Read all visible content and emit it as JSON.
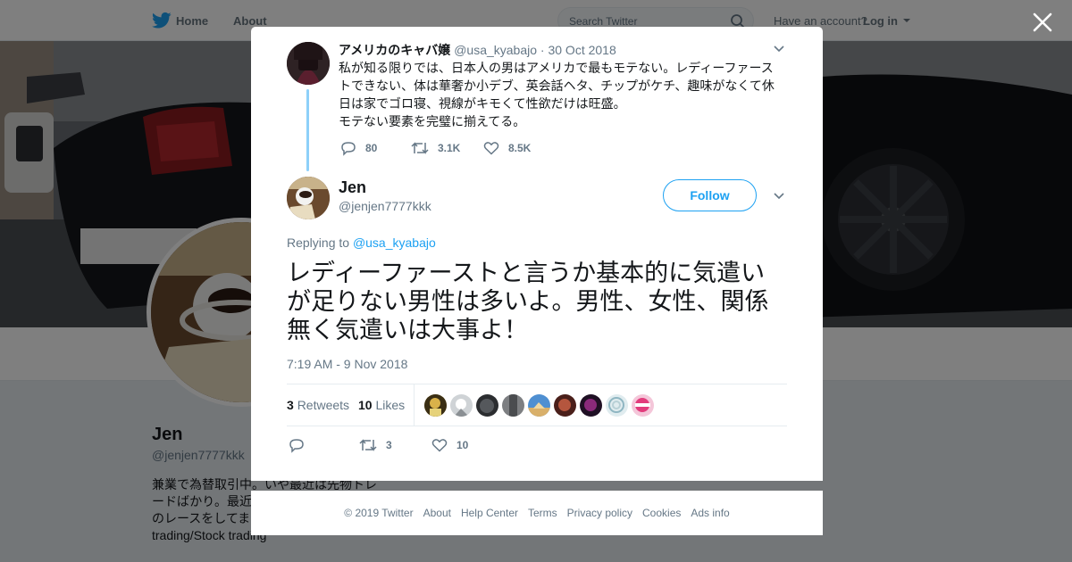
{
  "background": {
    "nav": {
      "home": "Home",
      "about": "About"
    },
    "search": {
      "placeholder": "Search Twitter"
    },
    "account": {
      "prompt": "Have an account?",
      "login": "Log in"
    },
    "profile": {
      "name": "Jen",
      "handle": "@jenjen7777kkk",
      "bio_lines": [
        "兼業で為替取引中。いや最近は先物トレ",
        "ードばかり。最近",
        "のレースをしてま",
        "trading/Stock trading"
      ]
    }
  },
  "parent_tweet": {
    "name": "アメリカのキャバ嬢",
    "handle": "@usa_kyabajo",
    "date": "· 30 Oct 2018",
    "text_lines": [
      "私が知る限りでは、日本人の男はアメリカで最もモテない。レディーファース",
      "トできない、体は華奢か小デブ、英会話ヘタ、チップがケチ、趣味がなくて休",
      "日は家でゴロ寝、視線がキモくて性欲だけは旺盛。",
      "モテない要素を完璧に揃えてる。"
    ],
    "replies": "80",
    "retweets": "3.1K",
    "likes": "8.5K"
  },
  "main_tweet": {
    "name": "Jen",
    "handle": "@jenjen7777kkk",
    "follow_label": "Follow",
    "replying_prefix": "Replying to",
    "replying_to": "@usa_kyabajo",
    "text_lines": [
      "レディーファーストと言うか基本的に気遣い",
      "が足りない男性は多いよ。男性、女性、関係",
      "無く気遣いは大事よ！"
    ],
    "timestamp": "7:19 AM - 9 Nov 2018",
    "stats": {
      "retweets_count": "3",
      "retweets_label": "Retweets",
      "likes_count": "10",
      "likes_label": "Likes"
    },
    "action_retweets": "3",
    "action_likes": "10"
  },
  "footer": {
    "copyright": "© 2019 Twitter",
    "about": "About",
    "help": "Help Center",
    "terms": "Terms",
    "privacy": "Privacy policy",
    "cookies": "Cookies",
    "ads": "Ads info"
  },
  "colors": {
    "accent": "#1da1f2",
    "thread_line": "#8ed0f9",
    "muted_text": "#657786",
    "overlay": "rgba(0,0,0,0.5)"
  }
}
